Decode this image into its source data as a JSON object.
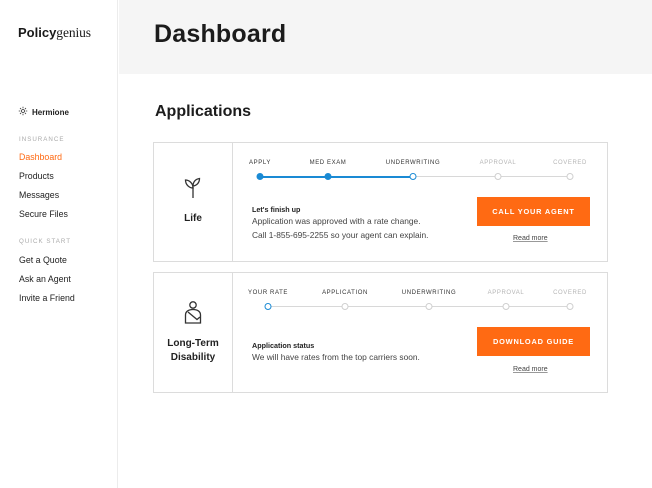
{
  "brand": {
    "bold": "Policy",
    "regular": "genius"
  },
  "user": {
    "name": "Hermione",
    "icon": "gear-icon"
  },
  "sidebar": {
    "insurance_label": "INSURANCE",
    "insurance_items": [
      "Dashboard",
      "Products",
      "Messages",
      "Secure Files"
    ],
    "active_item": "Dashboard",
    "quickstart_label": "QUICK START",
    "quickstart_items": [
      "Get a Quote",
      "Ask an Agent",
      "Invite a Friend"
    ]
  },
  "header": {
    "title": "Dashboard"
  },
  "applications": {
    "title": "Applications",
    "cards": [
      {
        "product": "Life",
        "icon": "sprout-icon",
        "steps": [
          {
            "label": "APPLY",
            "status": "done"
          },
          {
            "label": "MED EXAM",
            "status": "done"
          },
          {
            "label": "UNDERWRITING",
            "status": "current"
          },
          {
            "label": "APPROVAL",
            "status": "future"
          },
          {
            "label": "COVERED",
            "status": "future"
          }
        ],
        "message_title": "Let's finish up",
        "message_lines": [
          "Application was approved with a rate change.",
          "Call 1-855-695-2255 so your agent can explain."
        ],
        "cta_label": "CALL YOUR AGENT",
        "read_more": "Read more"
      },
      {
        "product_lines": [
          "Long-Term",
          "Disability"
        ],
        "icon": "person-arm-sling-icon",
        "steps": [
          {
            "label": "YOUR RATE",
            "status": "current"
          },
          {
            "label": "APPLICATION",
            "status": "future"
          },
          {
            "label": "UNDERWRITING",
            "status": "future"
          },
          {
            "label": "APPROVAL",
            "status": "future"
          },
          {
            "label": "COVERED",
            "status": "future"
          }
        ],
        "message_title": "Application status",
        "message_lines": [
          "We will have rates from the top carriers soon."
        ],
        "cta_label": "DOWNLOAD GUIDE",
        "read_more": "Read more"
      }
    ]
  },
  "colors": {
    "accent": "#ff6a13",
    "progress": "#1a8ad4",
    "header_bg": "#f5f5f5"
  }
}
